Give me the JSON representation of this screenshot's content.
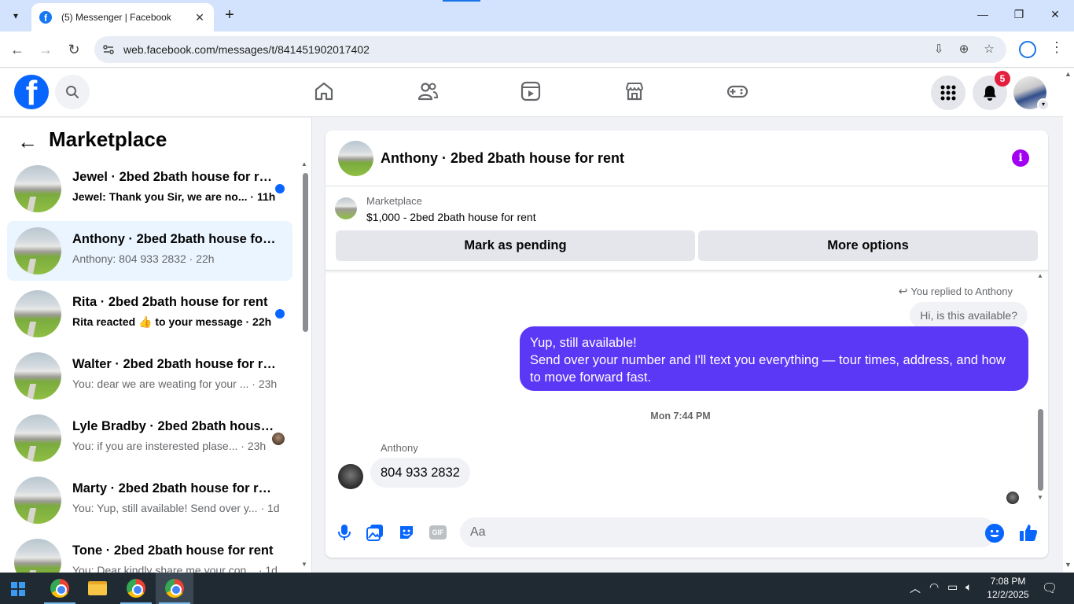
{
  "browser": {
    "tab_title": "(5) Messenger | Facebook",
    "favicon_letter": "f",
    "url": "web.facebook.com/messages/t/841451902017402",
    "new_tab": "+"
  },
  "fb": {
    "logo_letter": "f",
    "notification_count": "5",
    "nav": [
      "home-icon",
      "friends-icon",
      "video-icon",
      "marketplace-icon",
      "gaming-icon"
    ]
  },
  "sidebar": {
    "title": "Marketplace",
    "conversations": [
      {
        "name": "Jewel · 2bed 2bath house for rent",
        "preview": "Jewel: Thank you Sir, we are no... · 11h",
        "unread": true
      },
      {
        "name": "Anthony · 2bed 2bath house for rent",
        "preview": "Anthony: 804 933 2832 · 22h",
        "unread": false,
        "active": true
      },
      {
        "name": "Rita · 2bed 2bath house for rent",
        "preview": "Rita reacted 👍 to your message · 22h",
        "unread": true
      },
      {
        "name": "Walter · 2bed 2bath house for rent",
        "preview": "You: dear we are weating for your ... · 23h",
        "unread": false
      },
      {
        "name": "Lyle Bradby · 2bed 2bath house for rent",
        "preview": "You: if you are insterested plase... · 23h",
        "unread": false
      },
      {
        "name": "Marty · 2bed 2bath house for rent",
        "preview": "You: Yup, still available! Send over y... · 1d",
        "unread": false
      },
      {
        "name": "Tone · 2bed 2bath house for rent",
        "preview": "You: Dear kindly share me your con... · 1d",
        "unread": false
      }
    ]
  },
  "chat": {
    "title": "Anthony · 2bed 2bath house for rent",
    "info_glyph": "i",
    "listing_label": "Marketplace",
    "listing_price_title": "$1,000 - 2bed 2bath house for rent",
    "mark_pending": "Mark as pending",
    "more_options": "More options",
    "reply_note": "You replied to Anthony",
    "reply_quote": "Hi, is this available?",
    "outgoing_line1": "Yup, still available!",
    "outgoing_line2": "Send over your number and I'll text you everything — tour times, address, and how to move forward fast.",
    "time_divider": "Mon 7:44 PM",
    "incoming_sender": "Anthony",
    "incoming_text": "804 933 2832",
    "input_placeholder": "Aa",
    "gif_label": "GIF"
  },
  "taskbar": {
    "time": "7:08 PM",
    "date": "12/2/2025"
  },
  "colors": {
    "fb_blue": "#0866ff",
    "bubble_out": "#5b37f6",
    "info_purple": "#a100f2",
    "badge_red": "#e41e3f"
  }
}
